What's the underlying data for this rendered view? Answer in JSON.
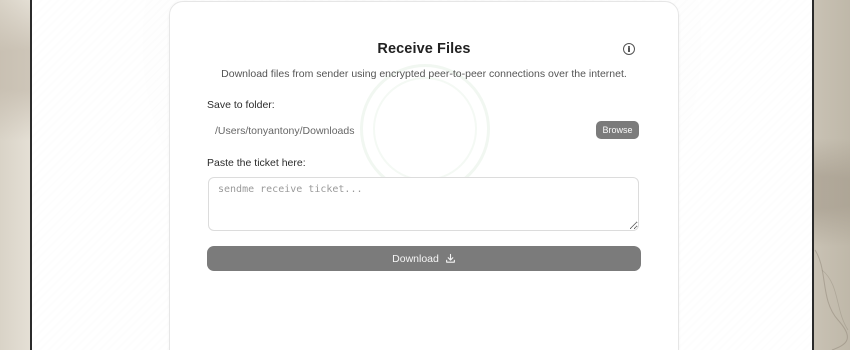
{
  "card": {
    "title": "Receive Files",
    "subtitle": "Download files from sender using encrypted peer-to-peer connections over the internet."
  },
  "folder": {
    "label": "Save to folder:",
    "path": "/Users/tonyantony/Downloads",
    "browse_label": "Browse"
  },
  "ticket": {
    "label": "Paste the ticket here:",
    "value": "",
    "placeholder": "sendme receive ticket..."
  },
  "download": {
    "label": "Download"
  },
  "icons": {
    "info": "info-icon",
    "download": "download-icon"
  },
  "colors": {
    "button_bg": "#7b7b7b",
    "window_bg": "#ffffff",
    "window_border": "#2a2a2a"
  }
}
